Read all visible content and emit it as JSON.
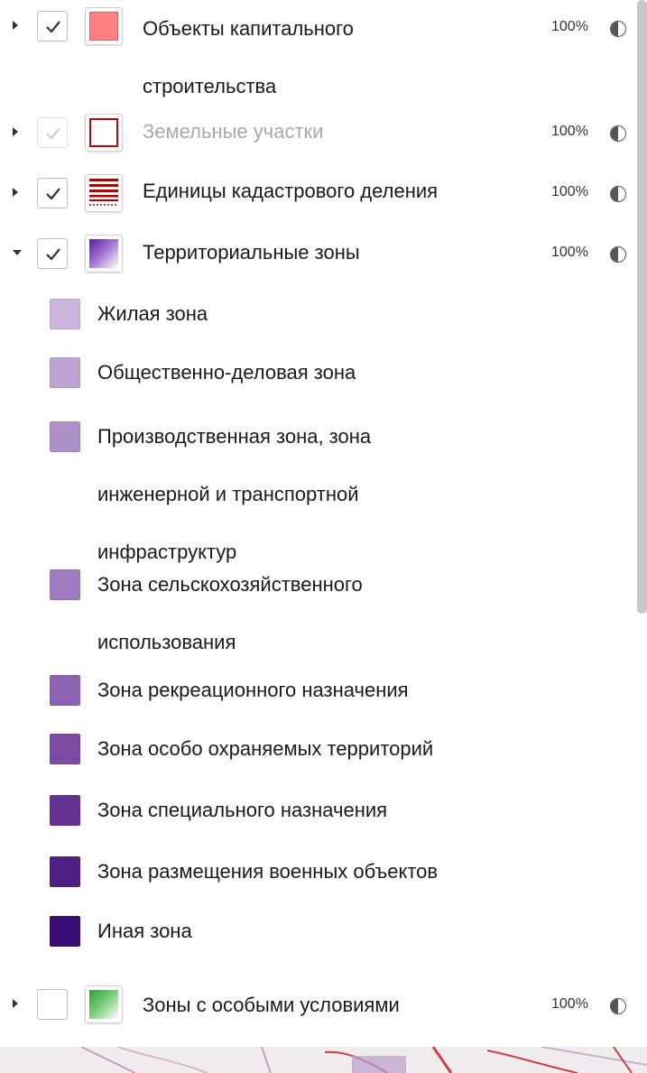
{
  "layers": [
    {
      "id": "oks",
      "title": "Объекты капитального строительства",
      "opacity": "100%",
      "checked": true,
      "disabled": false,
      "expanded": false
    },
    {
      "id": "zu",
      "title": "Земельные участки",
      "opacity": "100%",
      "checked": true,
      "disabled": true,
      "expanded": false
    },
    {
      "id": "ekd",
      "title": "Единицы кадастрового деления",
      "opacity": "100%",
      "checked": true,
      "disabled": false,
      "expanded": false
    },
    {
      "id": "tz",
      "title": "Территориальные зоны",
      "opacity": "100%",
      "checked": true,
      "disabled": false,
      "expanded": true
    },
    {
      "id": "zouit",
      "title": "Зоны с особыми условиями использования территории",
      "opacity": "100%",
      "checked": false,
      "disabled": false,
      "expanded": false
    }
  ],
  "legend": [
    {
      "label": "Жилая зона",
      "color": "#cdb6dd"
    },
    {
      "label": "Общественно-деловая зона",
      "color": "#bea3d2"
    },
    {
      "label": "Производственная зона, зона инженерной и транспортной инфраструктур",
      "color": "#ae90c8"
    },
    {
      "label": "Зона сельскохозяйственного использования",
      "color": "#9f7bbf"
    },
    {
      "label": "Зона рекреационного назначения",
      "color": "#8e63b2"
    },
    {
      "label": "Зона особо охраняемых территорий",
      "color": "#7b4ba4"
    },
    {
      "label": "Зона специального назначения",
      "color": "#643293"
    },
    {
      "label": "Зона размещения военных объектов",
      "color": "#4f1f83"
    },
    {
      "label": "Иная зона",
      "color": "#3a0b76"
    }
  ],
  "icons": {
    "expand_collapsed": "caret-right-icon",
    "expand_expanded": "caret-down-icon",
    "checkbox_check": "checkmark-icon",
    "opacity": "half-circle-opacity-icon"
  },
  "colors": {
    "oks_fill": "#ff8080",
    "zu_border": "#c00000",
    "ekd_lines": "#b00000",
    "tz_gradient": [
      "#5a1fa0",
      "#ffffff"
    ],
    "zouit_gradient": [
      "#2e9e2e",
      "#ffffff"
    ]
  }
}
